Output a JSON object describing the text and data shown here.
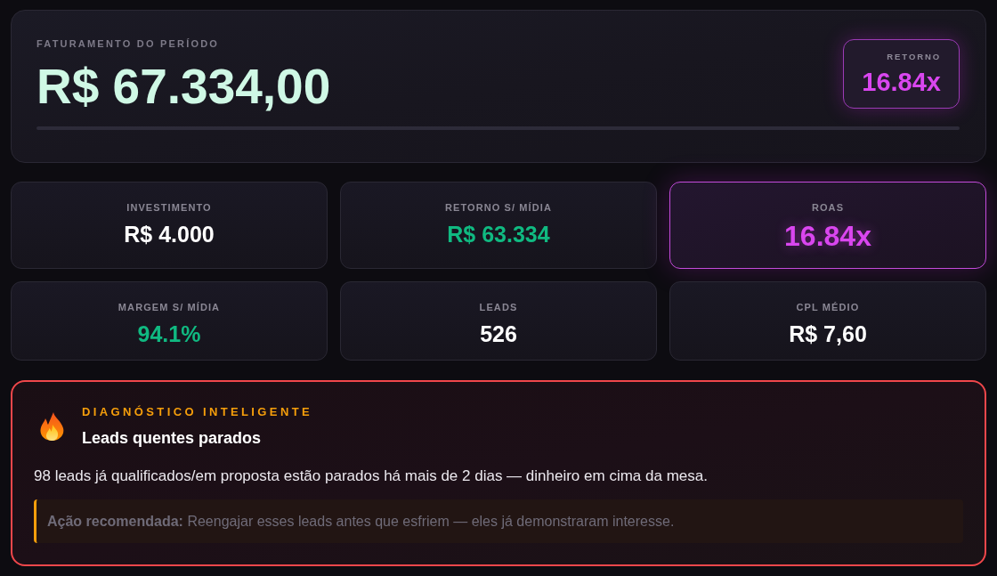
{
  "revenue": {
    "label": "FATURAMENTO DO PERÍODO",
    "value": "R$ 67.334,00",
    "progress": {
      "level": 0
    },
    "badge": {
      "label": "RETORNO",
      "value": "16.84x"
    }
  },
  "metrics": [
    {
      "label": "INVESTIMENTO",
      "value": "R$ 4.000",
      "color": "#ffffff",
      "highlighted": false
    },
    {
      "label": "RETORNO S/ MÍDIA",
      "value": "R$ 63.334",
      "color": "#10b981",
      "highlighted": false
    },
    {
      "label": "ROAS",
      "value": "16.84x",
      "color": "#d946ef",
      "highlighted": true
    },
    {
      "label": "MARGEM S/ MÍDIA",
      "value": "94.1%",
      "color": "#10b981",
      "highlighted": false
    },
    {
      "label": "LEADS",
      "value": "526",
      "color": "#ffffff",
      "highlighted": false
    },
    {
      "label": "CPL MÉDIO",
      "value": "R$ 7,60",
      "color": "#ffffff",
      "highlighted": false
    }
  ],
  "diagnostic": {
    "eyebrow": "DIAGNÓSTICO INTELIGENTE",
    "title": "Leads quentes parados",
    "message": "98 leads já qualificados/em proposta estão parados há mais de 2 dias — dinheiro em cima da mesa.",
    "recommendation": "**Ação recomendada:** Reengajar esses leads antes que esfriem — eles já demonstraram interesse."
  }
}
